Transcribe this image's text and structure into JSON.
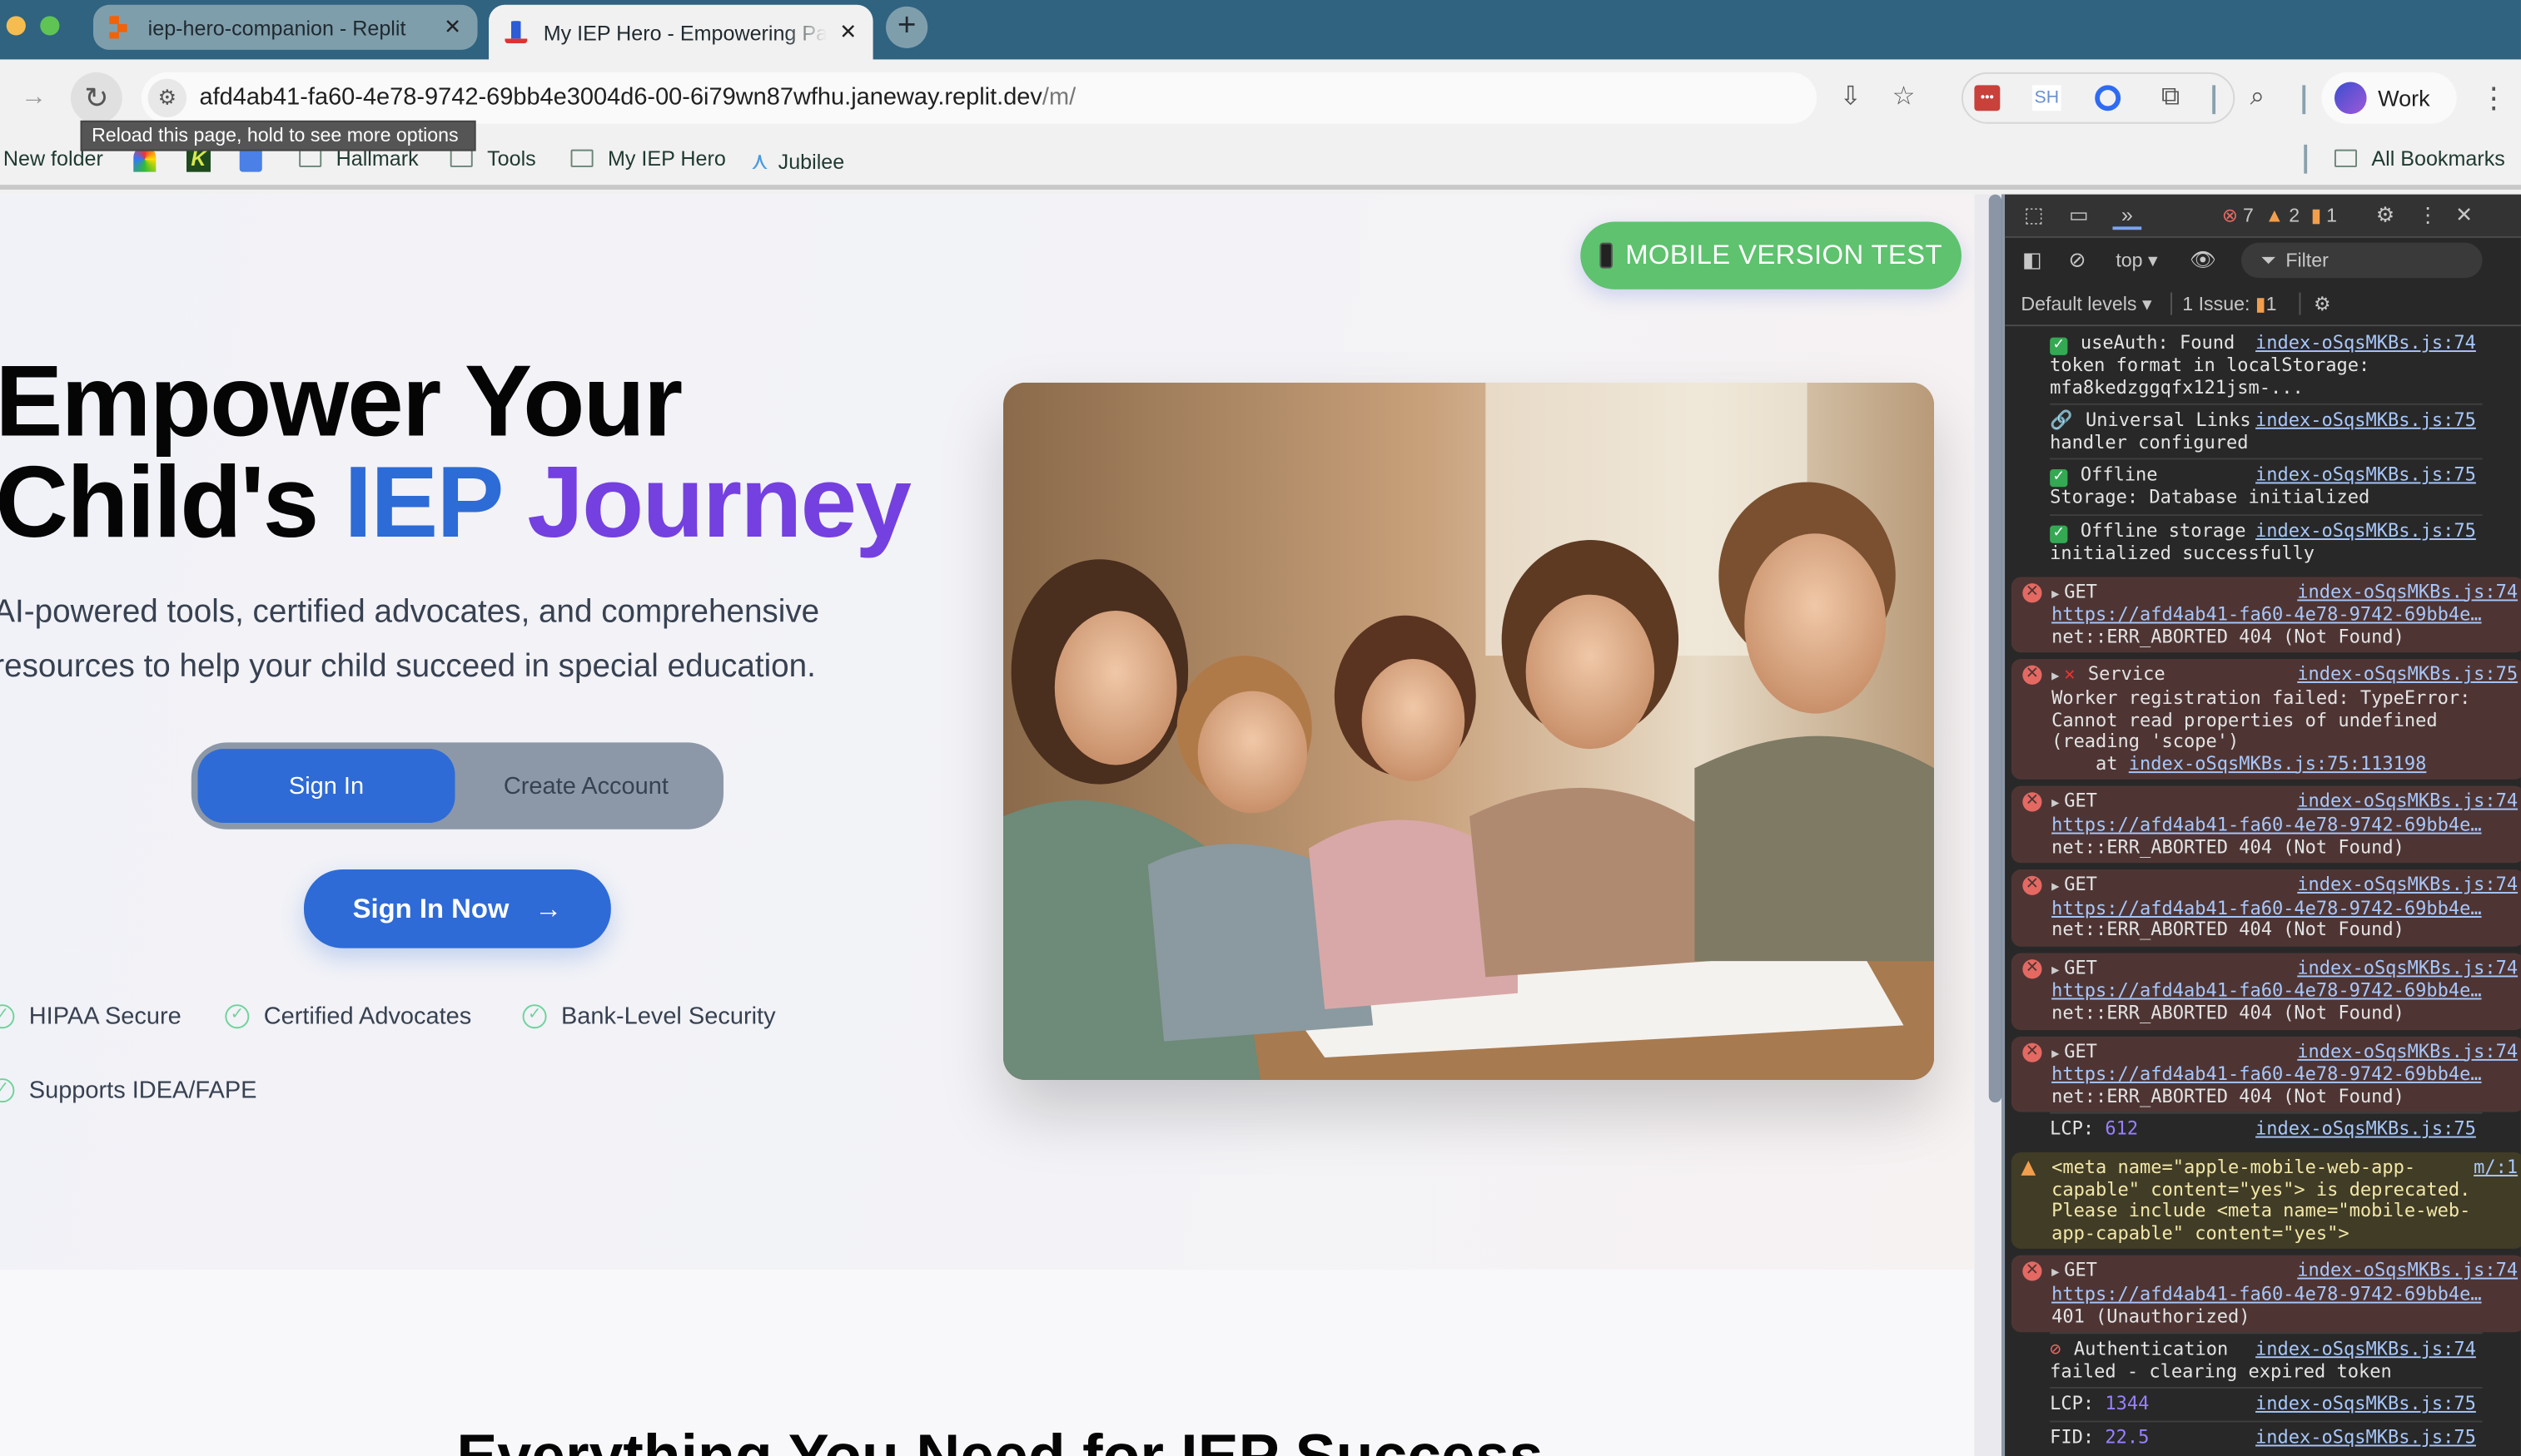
{
  "browser": {
    "tabs": [
      {
        "title": "iep-hero-companion - Replit",
        "active": false
      },
      {
        "title": "My IEP Hero - Empowering Pa",
        "active": true
      }
    ],
    "new_tab": "+",
    "url_host": "afd4ab41-fa60-4e78-9742-69bb4e3004d6-00-6i79wn87wfhu.janeway.replit.dev",
    "url_path": "/m/",
    "tooltip": "Reload this page, hold to see more options",
    "extensions": [
      "lastpass",
      "SH",
      "coda",
      "puzzle"
    ],
    "profile_label": "Work",
    "bookmarks": [
      {
        "label": "New folder",
        "type": "text"
      },
      {
        "label": "Hallmark",
        "type": "folder"
      },
      {
        "label": "Tools",
        "type": "folder"
      },
      {
        "label": "My IEP Hero",
        "type": "folder"
      },
      {
        "label": "Jubilee",
        "type": "app"
      }
    ],
    "all_bookmarks": "All Bookmarks"
  },
  "page": {
    "mobile_test_button": "MOBILE VERSION TEST",
    "headline_line1": "Empower Your",
    "headline_line2_a": "Child's ",
    "headline_iep": "IEP",
    "headline_journey": "Journey",
    "lead_line1": "AI-powered tools, certified advocates, and comprehensive",
    "lead_line2": "resources to help your child succeed in special education.",
    "toggle": {
      "sign_in": "Sign In",
      "create_account": "Create Account",
      "active": "sign_in"
    },
    "cta": "Sign In Now",
    "cta_arrow": "→",
    "features": [
      "HIPAA Secure",
      "Certified Advocates",
      "Bank-Level Security",
      "Supports IDEA/FAPE"
    ],
    "section_heading": "Everything You Need for IEP Success",
    "colors": {
      "primary": "#2e6bd6",
      "accent": "#7440e0",
      "success": "#5ec26e"
    }
  },
  "devtools": {
    "counts": {
      "errors": "7",
      "warnings": "2",
      "issues": "1"
    },
    "context": "top",
    "filter_placeholder": "Filter",
    "levels": "Default levels",
    "issues_label": "1 Issue:",
    "issues_count": "1",
    "prompt": ">",
    "entries": [
      {
        "level": "info",
        "icon": "check",
        "head": "useAuth: Found",
        "source": "index-oSqsMKBs.js:74",
        "lines": [
          "token format in localStorage:",
          "mfa8kedzggqfx121jsm-..."
        ]
      },
      {
        "level": "info",
        "icon": "link",
        "head": "Universal Links",
        "source": "index-oSqsMKBs.js:75",
        "lines": [
          "handler configured"
        ]
      },
      {
        "level": "info",
        "icon": "check",
        "head": "Offline",
        "source": "index-oSqsMKBs.js:75",
        "lines": [
          "Storage: Database initialized"
        ]
      },
      {
        "level": "info",
        "icon": "check",
        "head": "Offline storage",
        "source": "index-oSqsMKBs.js:75",
        "lines": [
          "initialized successfully"
        ]
      },
      {
        "level": "error",
        "expand": true,
        "head": "GET",
        "source": "index-oSqsMKBs.js:74",
        "net": true,
        "url": "https://afd4ab41-fa60-4e78-9742-69bb4e…",
        "lines": [
          "net::ERR_ABORTED 404 (Not Found)"
        ]
      },
      {
        "level": "error",
        "expand": true,
        "icon": "cross",
        "head": "Service",
        "source": "index-oSqsMKBs.js:75",
        "lines": [
          "Worker registration failed: TypeError:",
          "Cannot read properties of undefined",
          "(reading 'scope')"
        ],
        "at_prefix": "    at ",
        "at_link": "index-oSqsMKBs.js:75:113198"
      },
      {
        "level": "error",
        "expand": true,
        "head": "GET",
        "source": "index-oSqsMKBs.js:74",
        "net": true,
        "url": "https://afd4ab41-fa60-4e78-9742-69bb4e…",
        "lines": [
          "net::ERR_ABORTED 404 (Not Found)"
        ]
      },
      {
        "level": "error",
        "expand": true,
        "head": "GET",
        "source": "index-oSqsMKBs.js:74",
        "net": true,
        "url": "https://afd4ab41-fa60-4e78-9742-69bb4e…",
        "lines": [
          "net::ERR_ABORTED 404 (Not Found)"
        ]
      },
      {
        "level": "error",
        "expand": true,
        "head": "GET",
        "source": "index-oSqsMKBs.js:74",
        "net": true,
        "url": "https://afd4ab41-fa60-4e78-9742-69bb4e…",
        "lines": [
          "net::ERR_ABORTED 404 (Not Found)"
        ]
      },
      {
        "level": "error",
        "expand": true,
        "head": "GET",
        "source": "index-oSqsMKBs.js:74",
        "net": true,
        "url": "https://afd4ab41-fa60-4e78-9742-69bb4e…",
        "lines": [
          "net::ERR_ABORTED 404 (Not Found)"
        ]
      },
      {
        "level": "info",
        "head": "LCP: ",
        "value": "612",
        "source": "index-oSqsMKBs.js:75",
        "lines": []
      },
      {
        "level": "warning",
        "head": "<meta name=\"apple-mobile-web-app-",
        "source": "m/:1",
        "lines": [
          "capable\" content=\"yes\"> is deprecated.",
          "Please include <meta name=\"mobile-web-",
          "app-capable\" content=\"yes\">"
        ]
      },
      {
        "level": "error",
        "expand": true,
        "head": "GET",
        "source": "index-oSqsMKBs.js:74",
        "net": true,
        "url": "https://afd4ab41-fa60-4e78-9742-69bb4e…",
        "lines": [
          "401 (Unauthorized)"
        ]
      },
      {
        "level": "info",
        "icon": "prohibited",
        "head": "Authentication",
        "source": "index-oSqsMKBs.js:74",
        "lines": [
          "failed - clearing expired token"
        ]
      },
      {
        "level": "info",
        "head": "LCP: ",
        "value": "1344",
        "source": "index-oSqsMKBs.js:75",
        "lines": []
      },
      {
        "level": "info",
        "head": "FID: ",
        "value": "22.5",
        "source": "index-oSqsMKBs.js:75",
        "lines": []
      }
    ]
  }
}
